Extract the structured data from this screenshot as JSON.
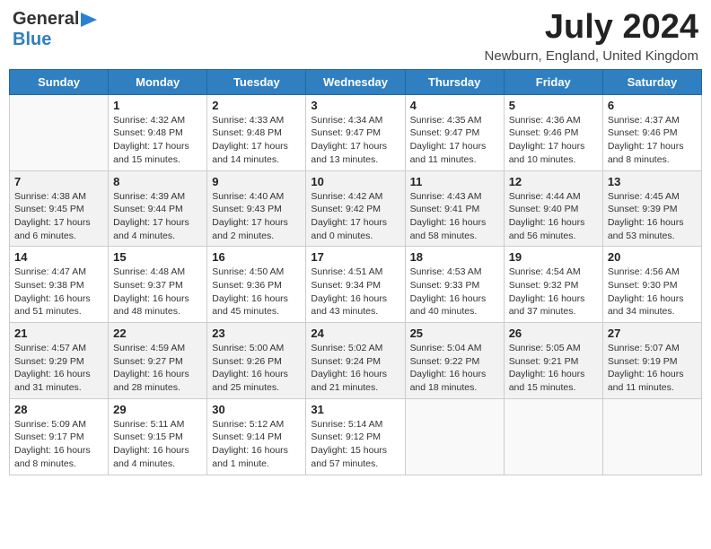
{
  "header": {
    "logo_line1": "General",
    "logo_line2": "Blue",
    "month_year": "July 2024",
    "location": "Newburn, England, United Kingdom"
  },
  "days_of_week": [
    "Sunday",
    "Monday",
    "Tuesday",
    "Wednesday",
    "Thursday",
    "Friday",
    "Saturday"
  ],
  "weeks": [
    [
      {
        "day": "",
        "info": ""
      },
      {
        "day": "1",
        "info": "Sunrise: 4:32 AM\nSunset: 9:48 PM\nDaylight: 17 hours\nand 15 minutes."
      },
      {
        "day": "2",
        "info": "Sunrise: 4:33 AM\nSunset: 9:48 PM\nDaylight: 17 hours\nand 14 minutes."
      },
      {
        "day": "3",
        "info": "Sunrise: 4:34 AM\nSunset: 9:47 PM\nDaylight: 17 hours\nand 13 minutes."
      },
      {
        "day": "4",
        "info": "Sunrise: 4:35 AM\nSunset: 9:47 PM\nDaylight: 17 hours\nand 11 minutes."
      },
      {
        "day": "5",
        "info": "Sunrise: 4:36 AM\nSunset: 9:46 PM\nDaylight: 17 hours\nand 10 minutes."
      },
      {
        "day": "6",
        "info": "Sunrise: 4:37 AM\nSunset: 9:46 PM\nDaylight: 17 hours\nand 8 minutes."
      }
    ],
    [
      {
        "day": "7",
        "info": "Sunrise: 4:38 AM\nSunset: 9:45 PM\nDaylight: 17 hours\nand 6 minutes."
      },
      {
        "day": "8",
        "info": "Sunrise: 4:39 AM\nSunset: 9:44 PM\nDaylight: 17 hours\nand 4 minutes."
      },
      {
        "day": "9",
        "info": "Sunrise: 4:40 AM\nSunset: 9:43 PM\nDaylight: 17 hours\nand 2 minutes."
      },
      {
        "day": "10",
        "info": "Sunrise: 4:42 AM\nSunset: 9:42 PM\nDaylight: 17 hours\nand 0 minutes."
      },
      {
        "day": "11",
        "info": "Sunrise: 4:43 AM\nSunset: 9:41 PM\nDaylight: 16 hours\nand 58 minutes."
      },
      {
        "day": "12",
        "info": "Sunrise: 4:44 AM\nSunset: 9:40 PM\nDaylight: 16 hours\nand 56 minutes."
      },
      {
        "day": "13",
        "info": "Sunrise: 4:45 AM\nSunset: 9:39 PM\nDaylight: 16 hours\nand 53 minutes."
      }
    ],
    [
      {
        "day": "14",
        "info": "Sunrise: 4:47 AM\nSunset: 9:38 PM\nDaylight: 16 hours\nand 51 minutes."
      },
      {
        "day": "15",
        "info": "Sunrise: 4:48 AM\nSunset: 9:37 PM\nDaylight: 16 hours\nand 48 minutes."
      },
      {
        "day": "16",
        "info": "Sunrise: 4:50 AM\nSunset: 9:36 PM\nDaylight: 16 hours\nand 45 minutes."
      },
      {
        "day": "17",
        "info": "Sunrise: 4:51 AM\nSunset: 9:34 PM\nDaylight: 16 hours\nand 43 minutes."
      },
      {
        "day": "18",
        "info": "Sunrise: 4:53 AM\nSunset: 9:33 PM\nDaylight: 16 hours\nand 40 minutes."
      },
      {
        "day": "19",
        "info": "Sunrise: 4:54 AM\nSunset: 9:32 PM\nDaylight: 16 hours\nand 37 minutes."
      },
      {
        "day": "20",
        "info": "Sunrise: 4:56 AM\nSunset: 9:30 PM\nDaylight: 16 hours\nand 34 minutes."
      }
    ],
    [
      {
        "day": "21",
        "info": "Sunrise: 4:57 AM\nSunset: 9:29 PM\nDaylight: 16 hours\nand 31 minutes."
      },
      {
        "day": "22",
        "info": "Sunrise: 4:59 AM\nSunset: 9:27 PM\nDaylight: 16 hours\nand 28 minutes."
      },
      {
        "day": "23",
        "info": "Sunrise: 5:00 AM\nSunset: 9:26 PM\nDaylight: 16 hours\nand 25 minutes."
      },
      {
        "day": "24",
        "info": "Sunrise: 5:02 AM\nSunset: 9:24 PM\nDaylight: 16 hours\nand 21 minutes."
      },
      {
        "day": "25",
        "info": "Sunrise: 5:04 AM\nSunset: 9:22 PM\nDaylight: 16 hours\nand 18 minutes."
      },
      {
        "day": "26",
        "info": "Sunrise: 5:05 AM\nSunset: 9:21 PM\nDaylight: 16 hours\nand 15 minutes."
      },
      {
        "day": "27",
        "info": "Sunrise: 5:07 AM\nSunset: 9:19 PM\nDaylight: 16 hours\nand 11 minutes."
      }
    ],
    [
      {
        "day": "28",
        "info": "Sunrise: 5:09 AM\nSunset: 9:17 PM\nDaylight: 16 hours\nand 8 minutes."
      },
      {
        "day": "29",
        "info": "Sunrise: 5:11 AM\nSunset: 9:15 PM\nDaylight: 16 hours\nand 4 minutes."
      },
      {
        "day": "30",
        "info": "Sunrise: 5:12 AM\nSunset: 9:14 PM\nDaylight: 16 hours\nand 1 minute."
      },
      {
        "day": "31",
        "info": "Sunrise: 5:14 AM\nSunset: 9:12 PM\nDaylight: 15 hours\nand 57 minutes."
      },
      {
        "day": "",
        "info": ""
      },
      {
        "day": "",
        "info": ""
      },
      {
        "day": "",
        "info": ""
      }
    ]
  ]
}
